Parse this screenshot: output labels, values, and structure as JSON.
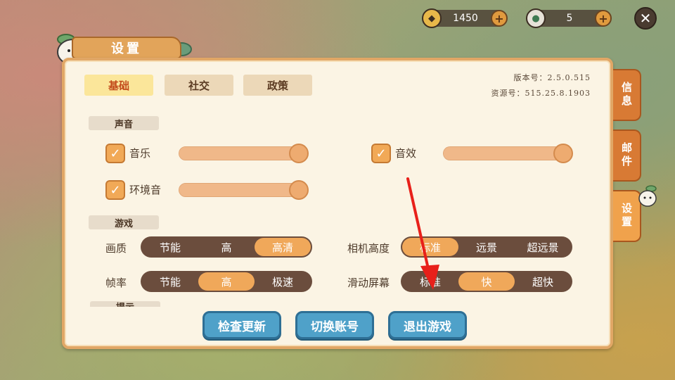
{
  "currency": {
    "coins": {
      "value": "1450",
      "icon": "coin-icon",
      "add_icon": "plus-icon"
    },
    "gems": {
      "value": "5",
      "icon": "gem-icon",
      "add_icon": "plus-icon"
    }
  },
  "close": {
    "glyph": "✕",
    "icon": "close-icon"
  },
  "title": "设置",
  "tabs": [
    {
      "label": "基础",
      "active": true
    },
    {
      "label": "社交",
      "active": false
    },
    {
      "label": "政策",
      "active": false
    }
  ],
  "version": {
    "app": "版本号：2.5.0.515",
    "resource": "资源号：515.25.8.1903"
  },
  "sections": {
    "sound": "声音",
    "game": "游戏",
    "next": "提示"
  },
  "sound": {
    "music": {
      "label": "音乐",
      "checked": true,
      "level": 1.0
    },
    "effects": {
      "label": "音效",
      "checked": true,
      "level": 1.0
    },
    "ambient": {
      "label": "环境音",
      "checked": true,
      "level": 1.0
    },
    "check_glyph": "✓"
  },
  "game": {
    "quality": {
      "label": "画质",
      "options": [
        "节能",
        "高",
        "高清"
      ],
      "selected": 2
    },
    "framerate": {
      "label": "帧率",
      "options": [
        "节能",
        "高",
        "极速"
      ],
      "selected": 1
    },
    "camera": {
      "label": "相机高度",
      "options": [
        "标准",
        "远景",
        "超远景"
      ],
      "selected": 0
    },
    "scroll": {
      "label": "滑动屏幕",
      "options": [
        "标准",
        "快",
        "超快"
      ],
      "selected": 1
    }
  },
  "buttons": {
    "check_update": "检查更新",
    "switch_account": "切换账号",
    "exit_game": "退出游戏"
  },
  "side_tabs": [
    {
      "label": "信息",
      "active": false
    },
    {
      "label": "邮件",
      "active": false
    },
    {
      "label": "设置",
      "active": true
    }
  ],
  "colors": {
    "panel_bg": "#fbf4e4",
    "panel_border": "#e1a766",
    "accent": "#f0a85a",
    "button_blue": "#4fa1c9",
    "annotation_arrow": "#e8201a"
  }
}
